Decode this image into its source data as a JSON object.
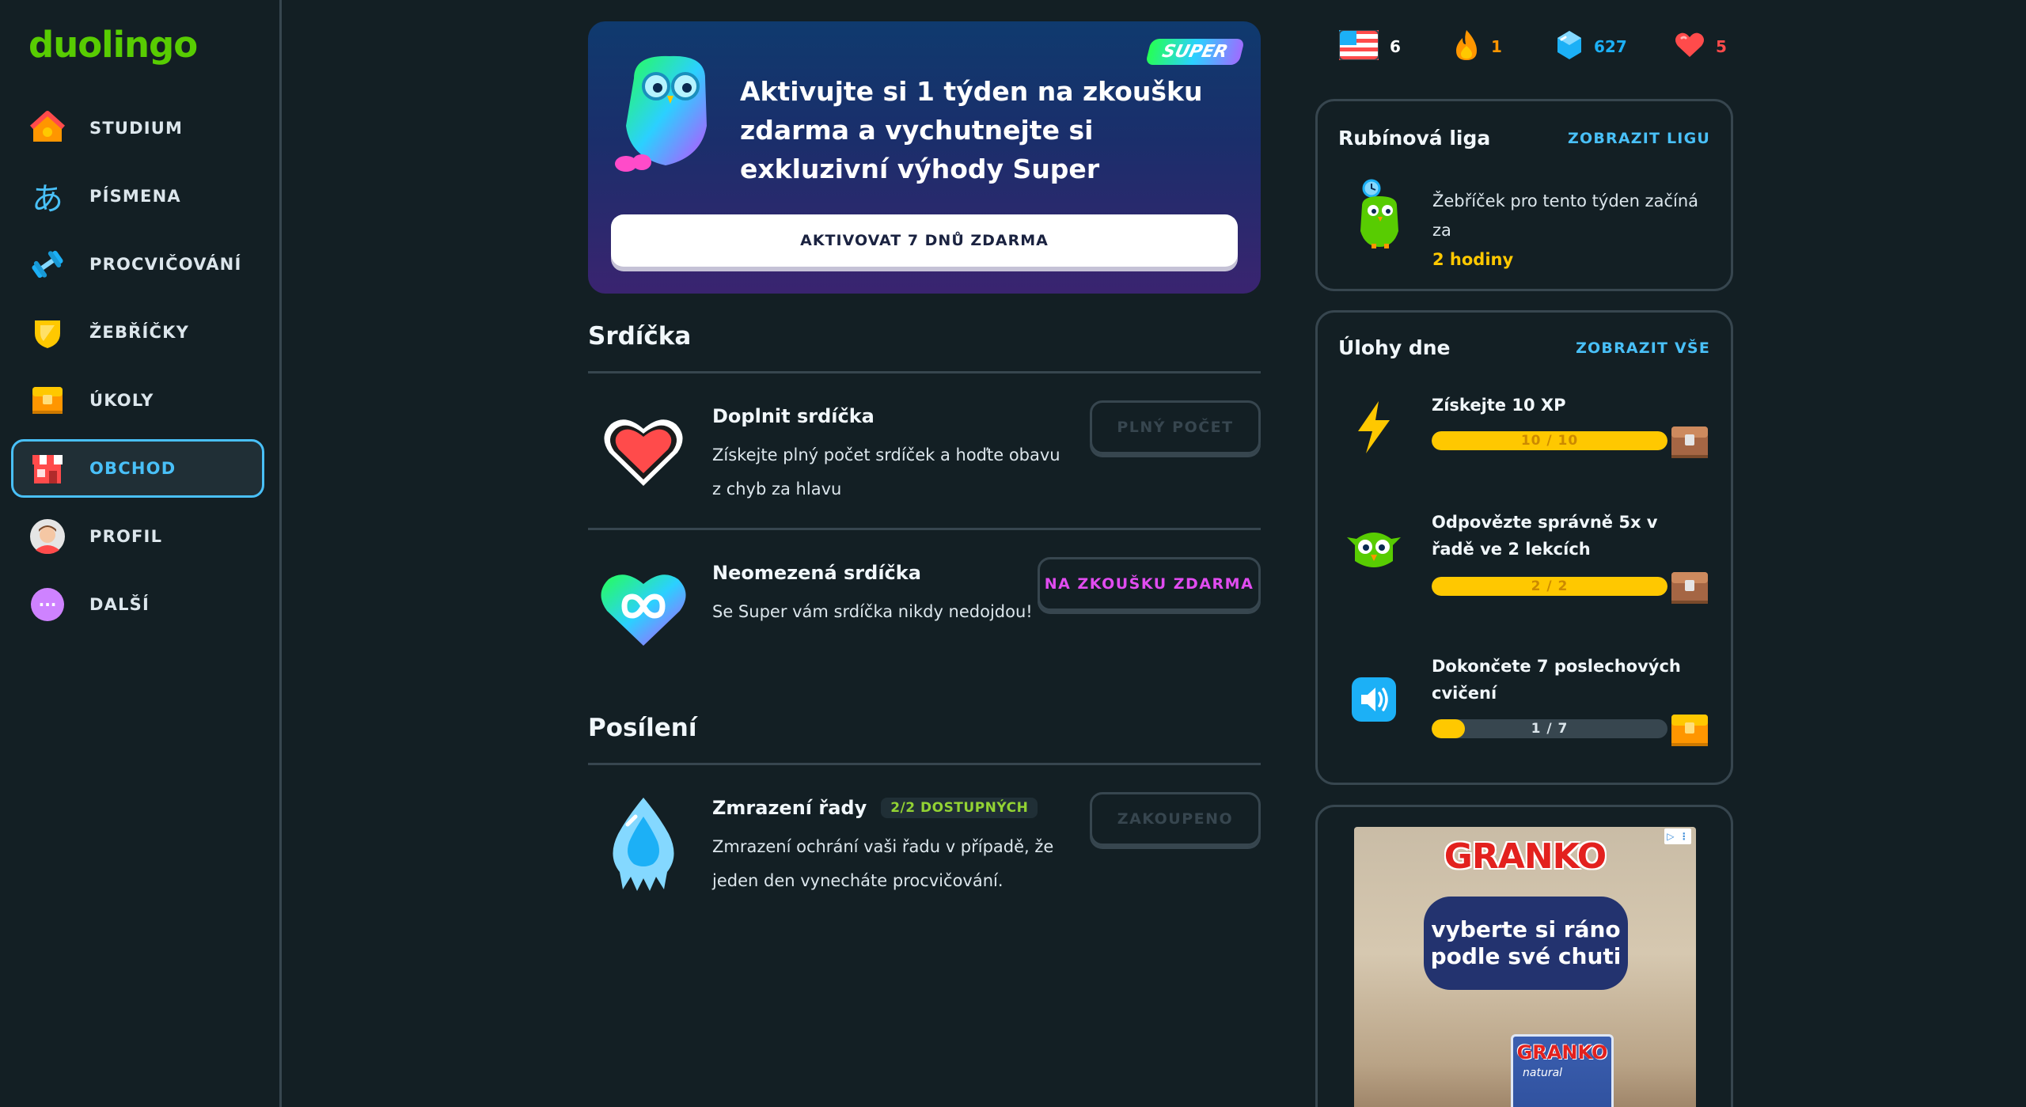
{
  "app": {
    "logo": "duolingo"
  },
  "sidebar": {
    "items": [
      {
        "label": "STUDIUM",
        "icon": "home-icon",
        "active": false
      },
      {
        "label": "PÍSMENA",
        "icon": "characters-icon",
        "glyph": "あ",
        "active": false
      },
      {
        "label": "PROCVIČOVÁNÍ",
        "icon": "dumbbell-icon",
        "active": false
      },
      {
        "label": "ŽEBŘÍČKY",
        "icon": "shield-icon",
        "active": false
      },
      {
        "label": "ÚKOLY",
        "icon": "chest-icon",
        "active": false
      },
      {
        "label": "OBCHOD",
        "icon": "shop-icon",
        "active": true
      },
      {
        "label": "PROFIL",
        "icon": "avatar-icon",
        "active": false
      },
      {
        "label": "DALŠÍ",
        "icon": "more-icon",
        "glyph": "···",
        "active": false
      }
    ]
  },
  "promo": {
    "badge": "SUPER",
    "title": "Aktivujte si 1 týden na zkoušku zdarma a vychutnejte si exkluzivní výhody Super",
    "button": "AKTIVOVAT 7 DNŮ ZDARMA"
  },
  "hearts_section": {
    "title": "Srdíčka",
    "items": [
      {
        "title": "Doplnit srdíčka",
        "desc": "Získejte plný počet srdíček a hoďte obavu z chyb za hlavu",
        "button": "PLNÝ POČET",
        "icon": "heart-refill-icon"
      },
      {
        "title": "Neomezená srdíčka",
        "desc": "Se Super vám srdíčka nikdy nedojdou!",
        "button": "NA ZKOUŠKU ZDARMA",
        "icon": "infinite-heart-icon"
      }
    ]
  },
  "powerups_section": {
    "title": "Posílení",
    "items": [
      {
        "title": "Zmrazení řady",
        "badge": "2/2 DOSTUPNÝCH",
        "desc": "Zmrazení ochrání vaši řadu v případě, že jeden den vynecháte procvičování.",
        "button": "ZAKOUPENO",
        "icon": "streak-freeze-icon"
      }
    ]
  },
  "stats": {
    "language": {
      "icon": "us-flag-icon",
      "value": "6"
    },
    "streak": {
      "icon": "flame-icon",
      "value": "1",
      "color": "#ff9600"
    },
    "gems": {
      "icon": "gem-icon",
      "value": "627",
      "color": "#1cb0f6"
    },
    "hearts": {
      "icon": "heart-icon",
      "value": "5",
      "color": "#ff4b4b"
    }
  },
  "league": {
    "title": "Rubínová liga",
    "link": "ZOBRAZIT LIGU",
    "text": "Žebříček pro tento týden začíná za",
    "time": "2 hodiny"
  },
  "quests": {
    "title": "Úlohy dne",
    "link": "ZOBRAZIT VŠE",
    "items": [
      {
        "title": "Získejte 10 XP",
        "progress_text": "10 / 10",
        "progress": 1.0,
        "icon": "lightning-icon"
      },
      {
        "title": "Odpovězte správně 5x v řadě ve 2 lekcích",
        "progress_text": "2 / 2",
        "progress": 1.0,
        "icon": "owl-icon"
      },
      {
        "title": "Dokončete 7 poslechových cvičení",
        "progress_text": "1 / 7",
        "progress": 0.14,
        "icon": "speaker-icon"
      }
    ]
  },
  "ad": {
    "brand": "GRANKO",
    "bubble": "vyberte si ráno podle své chuti",
    "box_brand": "GRANKO",
    "box_sub": "natural"
  },
  "colors": {
    "background": "#131f24",
    "border": "#37464f",
    "accent_blue": "#49c0f8",
    "green": "#58cc02",
    "gold": "#ffc800",
    "pink": "#e14cf0"
  }
}
